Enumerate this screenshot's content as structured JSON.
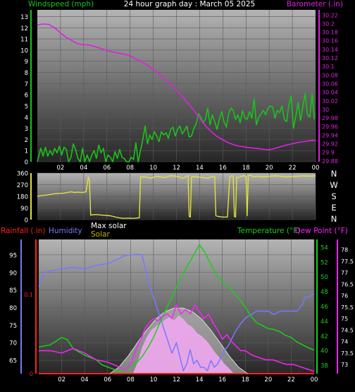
{
  "colors": {
    "wind": "#19c419",
    "baro": "#e020e0",
    "dir": "#e0e040",
    "rain": "#ff2020",
    "humidity": "#7878ff",
    "maxsolar": "#d8d8d8",
    "solar": "#c8b400",
    "temperature": "#19d019",
    "dewpoint": "#ff20ff",
    "label_white": "#ffffff"
  },
  "chart_data": [
    {
      "type": "line",
      "title": "24 hour graph day : March 05 2025",
      "left_label": "Windspeed (mph)",
      "right_label": "Barometer (.in)",
      "x_ticks": [
        "02",
        "04",
        "06",
        "08",
        "10",
        "12",
        "14",
        "16",
        "18",
        "20",
        "22",
        "00"
      ],
      "y_left_ticks": [
        "0",
        "1",
        "2",
        "3",
        "4",
        "5",
        "6",
        "7",
        "8",
        "9",
        "10",
        "11",
        "12",
        "13"
      ],
      "y_left_range": [
        0,
        13.6
      ],
      "y_right_ticks": [
        "29.88",
        "29.9",
        "29.92",
        "29.94",
        "29.96",
        "29.98",
        "30",
        "30.02",
        "30.04",
        "30.06",
        "30.08",
        "30.1",
        "30.12",
        "30.14",
        "30.16",
        "30.18",
        "30.2",
        "30.22"
      ],
      "y_right_range": [
        29.878,
        30.232
      ],
      "x_range": [
        0,
        24
      ],
      "series": [
        {
          "name": "Windspeed (mph)",
          "axis": "left",
          "x": [
            0,
            0.3,
            0.5,
            0.7,
            0.9,
            1.1,
            1.3,
            1.5,
            1.7,
            1.9,
            2.1,
            2.3,
            2.5,
            2.7,
            2.9,
            3.1,
            3.3,
            3.5,
            3.7,
            3.9,
            4.1,
            4.3,
            4.5,
            4.7,
            4.9,
            5.1,
            5.3,
            5.5,
            5.7,
            5.9,
            6.1,
            6.3,
            6.5,
            6.7,
            6.9,
            7.1,
            7.3,
            7.5,
            7.7,
            7.9,
            8.1,
            8.3,
            8.5,
            8.7,
            8.9,
            9.1,
            9.3,
            9.5,
            9.7,
            9.9,
            10.1,
            10.3,
            10.5,
            10.7,
            10.9,
            11.1,
            11.3,
            11.5,
            11.7,
            11.9,
            12.1,
            12.3,
            12.5,
            12.7,
            12.9,
            13.1,
            13.3,
            13.5,
            13.7,
            13.9,
            14.1,
            14.3,
            14.5,
            14.7,
            14.9,
            15.1,
            15.3,
            15.5,
            15.7,
            15.9,
            16.1,
            16.3,
            16.5,
            16.7,
            16.9,
            17.1,
            17.3,
            17.5,
            17.7,
            17.9,
            18.1,
            18.3,
            18.5,
            18.7,
            18.9,
            19.1,
            19.3,
            19.5,
            19.7,
            19.9,
            20.1,
            20.3,
            20.5,
            20.7,
            20.9,
            21.1,
            21.3,
            21.5,
            21.7,
            21.9,
            22.1,
            22.3,
            22.5,
            22.7,
            22.9,
            23.1,
            23.3,
            23.5,
            23.7,
            23.9
          ],
          "values": [
            0,
            1.2,
            0.5,
            1.3,
            0.5,
            1.0,
            0.6,
            1.2,
            0.8,
            1.4,
            0.6,
            1.3,
            1.1,
            0,
            0.4,
            1.6,
            1.1,
            0.3,
            0,
            1.2,
            0,
            0.6,
            0,
            0.6,
            1.0,
            0.3,
            1.5,
            0.8,
            1.2,
            0,
            0.6,
            0.4,
            0,
            0.9,
            0.3,
            1.1,
            0.4,
            0.3,
            0,
            0,
            0.4,
            0.2,
            1.7,
            0,
            1.0,
            2.0,
            3.2,
            1.6,
            2.4,
            2.0,
            2.7,
            2.3,
            1.8,
            2.7,
            2.4,
            2.6,
            2.1,
            2.9,
            3.1,
            2.3,
            2.9,
            3.2,
            2.5,
            2.8,
            3.2,
            2.2,
            2.3,
            3.0,
            3.4,
            4.3,
            4.0,
            3.5,
            3.8,
            4.8,
            3.3,
            4.2,
            3.6,
            2.9,
            3.8,
            4.5,
            3.6,
            3.1,
            4.3,
            4.8,
            4.6,
            3.8,
            4.2,
            3.5,
            4.6,
            3.9,
            3.8,
            4.5,
            3.9,
            5.6,
            3.3,
            4.0,
            4.3,
            4.6,
            4.2,
            4.8,
            5.0,
            4.9,
            3.9,
            4.6,
            4.4,
            5.0,
            3.8,
            3.6,
            5.1,
            5.9,
            3.0,
            4.1,
            5.3,
            3.7,
            4.9,
            6.1,
            4.2,
            4.0,
            6.1,
            3.8
          ]
        },
        {
          "name": "Barometer (.in)",
          "axis": "right",
          "x": [
            0,
            0.5,
            1,
            1.5,
            2,
            2.5,
            3,
            3.5,
            4,
            4.5,
            5,
            5.5,
            6,
            6.5,
            7,
            7.5,
            8,
            8.5,
            9,
            9.5,
            10,
            10.5,
            11,
            11.5,
            12,
            12.5,
            13,
            13.5,
            14,
            14.5,
            15,
            15.5,
            16,
            16.5,
            17,
            17.5,
            18,
            18.5,
            19,
            19.5,
            20,
            20.5,
            21,
            21.5,
            22,
            22.5,
            23,
            23.5,
            24
          ],
          "values": [
            30.197,
            30.199,
            30.198,
            30.19,
            30.178,
            30.168,
            30.16,
            30.153,
            30.151,
            30.15,
            30.146,
            30.142,
            30.137,
            30.134,
            30.131,
            30.129,
            30.125,
            30.118,
            30.111,
            30.103,
            30.093,
            30.083,
            30.072,
            30.058,
            30.045,
            30.03,
            30.014,
            29.998,
            29.98,
            29.962,
            29.948,
            29.937,
            29.929,
            29.922,
            29.917,
            29.914,
            29.912,
            29.91,
            29.909,
            29.907,
            29.906,
            29.909,
            29.913,
            29.917,
            29.92,
            29.923,
            29.925,
            29.927,
            29.928
          ]
        }
      ]
    },
    {
      "type": "line",
      "left_ticks": [
        "0",
        "90",
        "180",
        "270",
        "360"
      ],
      "y_range": [
        0,
        360
      ],
      "x_range": [
        0,
        24
      ],
      "compass_labels": [
        "N",
        "W",
        "S",
        "E",
        "N"
      ],
      "series": [
        {
          "name": "Wind direction",
          "x": [
            0,
            0.3,
            0.8,
            1.5,
            2.3,
            2.9,
            3.2,
            3.5,
            3.9,
            4.2,
            4.4,
            4.5,
            4.6,
            5.0,
            5.6,
            6.3,
            7.0,
            7.3,
            7.4,
            7.8,
            8.3,
            8.5,
            8.8,
            8.9,
            9.3,
            9.8,
            10.3,
            10.6,
            11.0,
            11.5,
            11.9,
            12.2,
            12.6,
            12.9,
            13.0,
            13.1,
            13.2,
            13.3,
            13.4,
            13.5,
            13.8,
            14.2,
            14.7,
            15.0,
            15.2,
            15.3,
            15.4,
            15.6,
            16.0,
            16.4,
            16.6,
            16.8,
            16.9,
            17.0,
            17.1,
            17.2,
            17.3,
            17.5,
            17.8,
            18.0,
            18.1,
            18.2,
            18.4,
            18.6,
            19.0,
            19.5,
            20.0,
            20.5,
            21.0,
            21.5,
            22.0,
            22.5,
            23.0,
            23.5,
            24.0
          ],
          "values": [
            180,
            185,
            190,
            200,
            205,
            215,
            210,
            212,
            210,
            215,
            330,
            300,
            35,
            40,
            35,
            30,
            15,
            12,
            10,
            12,
            10,
            12,
            15,
            330,
            330,
            320,
            335,
            330,
            325,
            340,
            335,
            330,
            320,
            335,
            340,
            25,
            20,
            330,
            335,
            330,
            330,
            325,
            320,
            330,
            330,
            335,
            30,
            25,
            20,
            20,
            330,
            340,
            335,
            25,
            20,
            330,
            325,
            330,
            340,
            335,
            30,
            340,
            345,
            330,
            335,
            330,
            335,
            338,
            335,
            330,
            333,
            335,
            338,
            336,
            338
          ]
        }
      ]
    },
    {
      "type": "line",
      "labels": {
        "rainfall": "Rainfall (.in)",
        "humidity": "Humidity",
        "maxsolar": "Max solar",
        "solar": "Solar",
        "temperature": "Temperature (°F)",
        "dewpoint": "Dew Point (°F)"
      },
      "x_ticks": [
        "02",
        "04",
        "06",
        "08",
        "10",
        "12",
        "14",
        "16",
        "18",
        "20",
        "22",
        "00"
      ],
      "x_range": [
        0,
        24
      ],
      "humidity_ticks": [
        "65",
        "70",
        "75",
        "80",
        "85",
        "90",
        "95"
      ],
      "humidity_range": [
        61.2,
        99.4
      ],
      "rain_ticks": [
        "0.1",
        "0"
      ],
      "rain_range": [
        0,
        0.17
      ],
      "temperature_ticks": [
        "38",
        "40",
        "42",
        "44",
        "46",
        "48",
        "50",
        "52",
        "54"
      ],
      "temperature_range": [
        36.9,
        55.1
      ],
      "dewpoint_ticks": [
        "73",
        "73.5",
        "74",
        "74.5",
        "75",
        "75.5",
        "76",
        "76.5",
        "77",
        "77.5",
        "78"
      ],
      "dewpoint_range": [
        72.6,
        78.45
      ],
      "series": [
        {
          "name": "Rainfall (.in)",
          "axis": "rain",
          "x": [
            0,
            24
          ],
          "values": [
            0,
            0
          ]
        },
        {
          "name": "Humidity",
          "axis": "humidity",
          "x": [
            0,
            0.5,
            1,
            2,
            3,
            4,
            5,
            6,
            7,
            7.5,
            8,
            8.5,
            9,
            9.3,
            9.6,
            10,
            10.4,
            10.8,
            11.2,
            11.6,
            12,
            12.3,
            12.6,
            12.9,
            13.2,
            13.5,
            13.8,
            14.1,
            14.4,
            14.7,
            15,
            15.3,
            15.6,
            15.9,
            16.2,
            16.5,
            16.8,
            17.1,
            17.5,
            18,
            18.5,
            19,
            19.5,
            20,
            20.5,
            21,
            21.5,
            22,
            22.5,
            23,
            23.2,
            23.5,
            24
          ],
          "values": [
            86,
            90,
            90.5,
            91,
            91.5,
            91,
            92,
            92.5,
            94,
            94.8,
            95,
            95.2,
            95,
            91,
            87,
            83,
            79,
            75,
            71,
            67,
            70,
            66,
            62,
            64,
            68,
            64,
            65,
            63,
            63,
            62,
            65,
            63,
            64,
            66,
            68,
            69,
            71,
            73,
            75,
            77,
            78,
            79,
            79,
            79,
            78,
            79,
            79,
            79,
            79,
            81,
            83,
            83,
            84
          ]
        },
        {
          "name": "Max solar",
          "axis": "temperature",
          "x": [
            6.2,
            7,
            7.8,
            8.6,
            9.4,
            10.2,
            11,
            11.8,
            12.6,
            13.4,
            14.2,
            15,
            15.8,
            16.6,
            17.4,
            18.2
          ],
          "values": [
            36.9,
            37.8,
            39.3,
            41.1,
            42.8,
            44.3,
            45.3,
            45.8,
            45.8,
            45.3,
            44.3,
            42.8,
            41.1,
            39.3,
            37.8,
            36.9
          ]
        },
        {
          "name": "Solar",
          "axis": "temperature",
          "x": [
            8.2,
            8.6,
            9,
            9.4,
            9.8,
            10.2,
            10.6,
            11,
            11.4,
            11.8,
            12.2,
            12.6,
            13,
            13.4,
            13.8,
            14.2,
            14.6,
            15,
            15.4,
            15.8,
            16.2,
            16.6,
            17
          ],
          "values": [
            36.9,
            38.4,
            40.4,
            41.8,
            42.8,
            43.3,
            43.8,
            44.2,
            44.6,
            44.1,
            44.8,
            44.3,
            43.6,
            43.2,
            42.4,
            42.0,
            41.4,
            40.6,
            39.7,
            39.0,
            38.2,
            37.6,
            36.9
          ]
        },
        {
          "name": "Temperature (°F)",
          "axis": "temperature",
          "x": [
            0,
            1,
            2,
            2.5,
            3,
            4,
            5,
            5.5,
            6,
            6.5,
            7,
            7.5,
            8,
            8.5,
            9,
            9.5,
            10,
            10.5,
            11,
            11.5,
            12,
            12.5,
            13,
            13.5,
            14,
            14.5,
            15,
            15.5,
            16,
            16.5,
            17,
            17.5,
            18,
            18.5,
            19,
            19.5,
            20,
            20.5,
            21,
            21.5,
            22,
            22.5,
            23,
            23.5,
            24
          ],
          "values": [
            40.5,
            40.8,
            41.8,
            41.5,
            40.3,
            39.4,
            38.8,
            38.1,
            37.8,
            37.5,
            37.2,
            37.3,
            37.8,
            38.3,
            39.2,
            40.4,
            41.8,
            43.6,
            45.3,
            46.9,
            48.6,
            50.2,
            51.6,
            53.0,
            54.4,
            53.3,
            51.7,
            50.2,
            49.3,
            48.8,
            47.8,
            47.0,
            45.9,
            44.7,
            43.8,
            43.4,
            43.0,
            42.9,
            42.6,
            42.1,
            41.8,
            41.2,
            40.8,
            40.4,
            40.1
          ]
        },
        {
          "name": "Dew Point (°F)",
          "axis": "dewpoint",
          "x": [
            0,
            1,
            2,
            3,
            4,
            5,
            6,
            7,
            7.5,
            8,
            8.3,
            8.6,
            9,
            9.3,
            9.6,
            10,
            10.4,
            10.8,
            11.2,
            11.6,
            12,
            12.4,
            12.8,
            13.2,
            13.6,
            14,
            14.4,
            14.8,
            15.2,
            15.6,
            16,
            16.4,
            16.8,
            17.2,
            17.6,
            18,
            18.6,
            19.2,
            19.8,
            20.4,
            21,
            21.6,
            22.2,
            22.8,
            23.4,
            24
          ],
          "values": [
            73.6,
            73.6,
            73.5,
            73.7,
            73.5,
            73.2,
            73.1,
            72.9,
            72.75,
            73.0,
            73.4,
            73.8,
            74.2,
            74.6,
            74.8,
            75.0,
            74.9,
            75.1,
            75.2,
            75.0,
            75.6,
            75.2,
            75.4,
            75.2,
            75.6,
            75.3,
            75.0,
            75.2,
            74.8,
            74.5,
            74.1,
            74.3,
            74.0,
            73.8,
            73.6,
            73.6,
            73.4,
            73.3,
            73.2,
            73.2,
            73.1,
            73.0,
            73.0,
            72.9,
            72.8,
            72.7
          ]
        }
      ]
    }
  ]
}
